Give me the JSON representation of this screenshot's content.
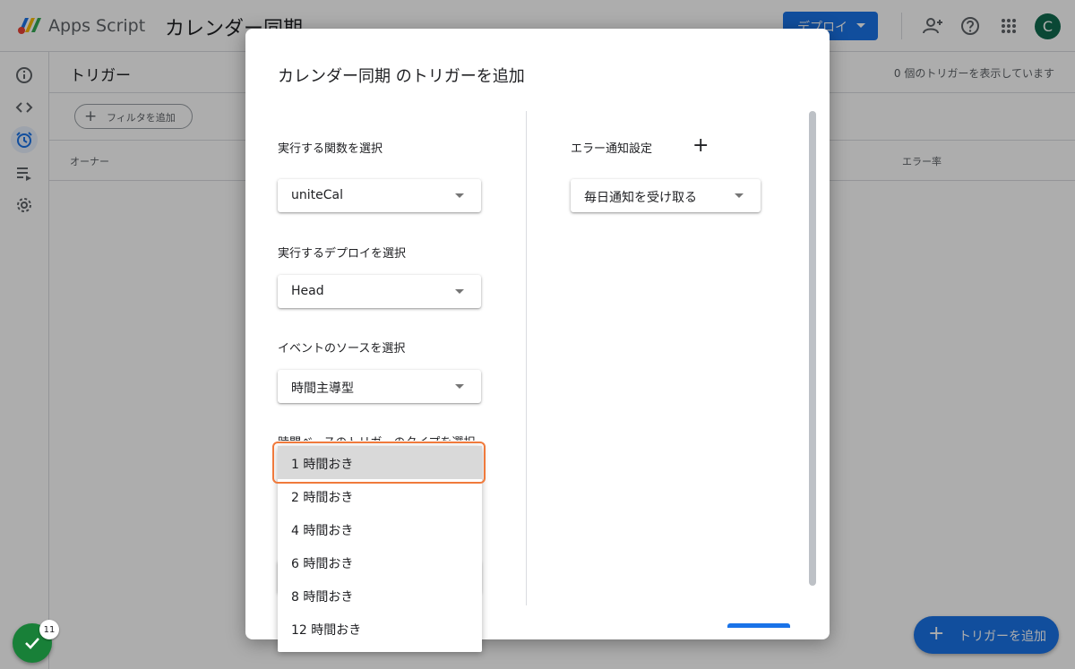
{
  "app": {
    "name": "Apps Script",
    "project_title": "カレンダー同期",
    "deploy_label": "デプロイ",
    "avatar_letter": "C"
  },
  "page": {
    "title": "トリガー",
    "count_text": "0 個のトリガーを表示しています",
    "filter_label": "フィルタを追加",
    "columns": {
      "owner": "オーナー",
      "error_rate": "エラー率"
    },
    "add_trigger_label": "トリガーを追加"
  },
  "status": {
    "badge_count": "11"
  },
  "dialog": {
    "title": "カレンダー同期 のトリガーを追加",
    "function_label": "実行する関数を選択",
    "function_value": "uniteCal",
    "deploy_label": "実行するデプロイを選択",
    "deploy_value": "Head",
    "event_source_label": "イベントのソースを選択",
    "event_source_value": "時間主導型",
    "trigger_type_label": "時間ベースのトリガーのタイプを選択",
    "error_notify_label": "エラー通知設定",
    "error_notify_value": "毎日通知を受け取る"
  },
  "dropdown": {
    "selected_index": 0,
    "options": [
      "1 時間おき",
      "2 時間おき",
      "4 時間おき",
      "6 時間おき",
      "8 時間おき",
      "12 時間おき"
    ]
  },
  "colors": {
    "accent": "#1a73e8",
    "highlight": "#f07a3c",
    "success": "#188038"
  }
}
